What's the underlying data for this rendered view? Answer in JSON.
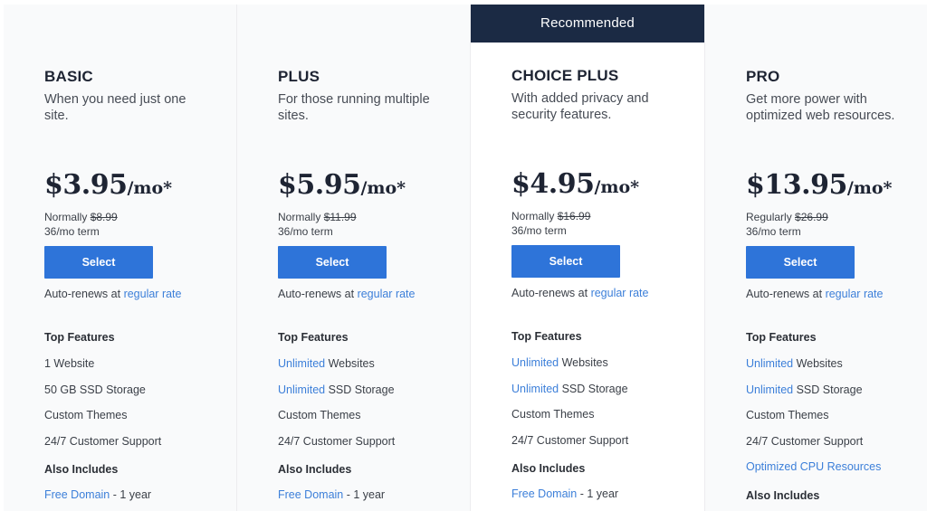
{
  "colors": {
    "primary_button": "#2e74d9",
    "link": "#3c7fd9",
    "recommended_banner": "#1b2a44",
    "heading_text": "#1e2433"
  },
  "plans": [
    {
      "name": "BASIC",
      "description": "When you need just one site.",
      "price": "$3.95",
      "per": "/mo*",
      "normal_label": "Normally",
      "normal_price": "$8.99",
      "term": "36/mo term",
      "button": "Select",
      "autorenew_text": "Auto-renews at",
      "autorenew_link": "regular rate",
      "top_features_title": "Top Features",
      "features": [
        {
          "highlight": "",
          "text": "1 Website"
        },
        {
          "highlight": "",
          "text": "50 GB SSD Storage"
        },
        {
          "highlight": "",
          "text": "Custom Themes"
        },
        {
          "highlight": "",
          "text": "24/7 Customer Support"
        }
      ],
      "also_includes_title": "Also Includes",
      "also_includes": [
        {
          "link": "Free Domain",
          "text": " - 1 year"
        }
      ]
    },
    {
      "name": "PLUS",
      "description": "For those running multiple sites.",
      "price": "$5.95",
      "per": "/mo*",
      "normal_label": "Normally",
      "normal_price": "$11.99",
      "term": "36/mo term",
      "button": "Select",
      "autorenew_text": "Auto-renews at",
      "autorenew_link": "regular rate",
      "top_features_title": "Top Features",
      "features": [
        {
          "highlight": "Unlimited",
          "text": " Websites"
        },
        {
          "highlight": "Unlimited",
          "text": " SSD Storage"
        },
        {
          "highlight": "",
          "text": "Custom Themes"
        },
        {
          "highlight": "",
          "text": "24/7 Customer Support"
        }
      ],
      "also_includes_title": "Also Includes",
      "also_includes": [
        {
          "link": "Free Domain",
          "text": " - 1 year"
        }
      ]
    },
    {
      "recommended_label": "Recommended",
      "name": "CHOICE PLUS",
      "description": "With added privacy and security features.",
      "price": "$4.95",
      "per": "/mo*",
      "normal_label": "Normally",
      "normal_price": "$16.99",
      "term": "36/mo term",
      "button": "Select",
      "autorenew_text": "Auto-renews at",
      "autorenew_link": "regular rate",
      "top_features_title": "Top Features",
      "features": [
        {
          "highlight": "Unlimited",
          "text": " Websites"
        },
        {
          "highlight": "Unlimited",
          "text": " SSD Storage"
        },
        {
          "highlight": "",
          "text": "Custom Themes"
        },
        {
          "highlight": "",
          "text": "24/7 Customer Support"
        }
      ],
      "also_includes_title": "Also Includes",
      "also_includes": [
        {
          "link": "Free Domain",
          "text": " - 1 year"
        }
      ]
    },
    {
      "name": "PRO",
      "description": "Get more power with optimized web resources.",
      "price": "$13.95",
      "per": "/mo*",
      "normal_label": "Regularly",
      "normal_price": "$26.99",
      "term": "36/mo term",
      "button": "Select",
      "autorenew_text": "Auto-renews at",
      "autorenew_link": "regular rate",
      "top_features_title": "Top Features",
      "features": [
        {
          "highlight": "Unlimited",
          "text": " Websites"
        },
        {
          "highlight": "Unlimited",
          "text": " SSD Storage"
        },
        {
          "highlight": "",
          "text": "Custom Themes"
        },
        {
          "highlight": "",
          "text": "24/7 Customer Support"
        },
        {
          "highlight": "Optimized CPU Resources",
          "text": ""
        }
      ],
      "also_includes_title": "Also Includes",
      "also_includes": []
    }
  ]
}
